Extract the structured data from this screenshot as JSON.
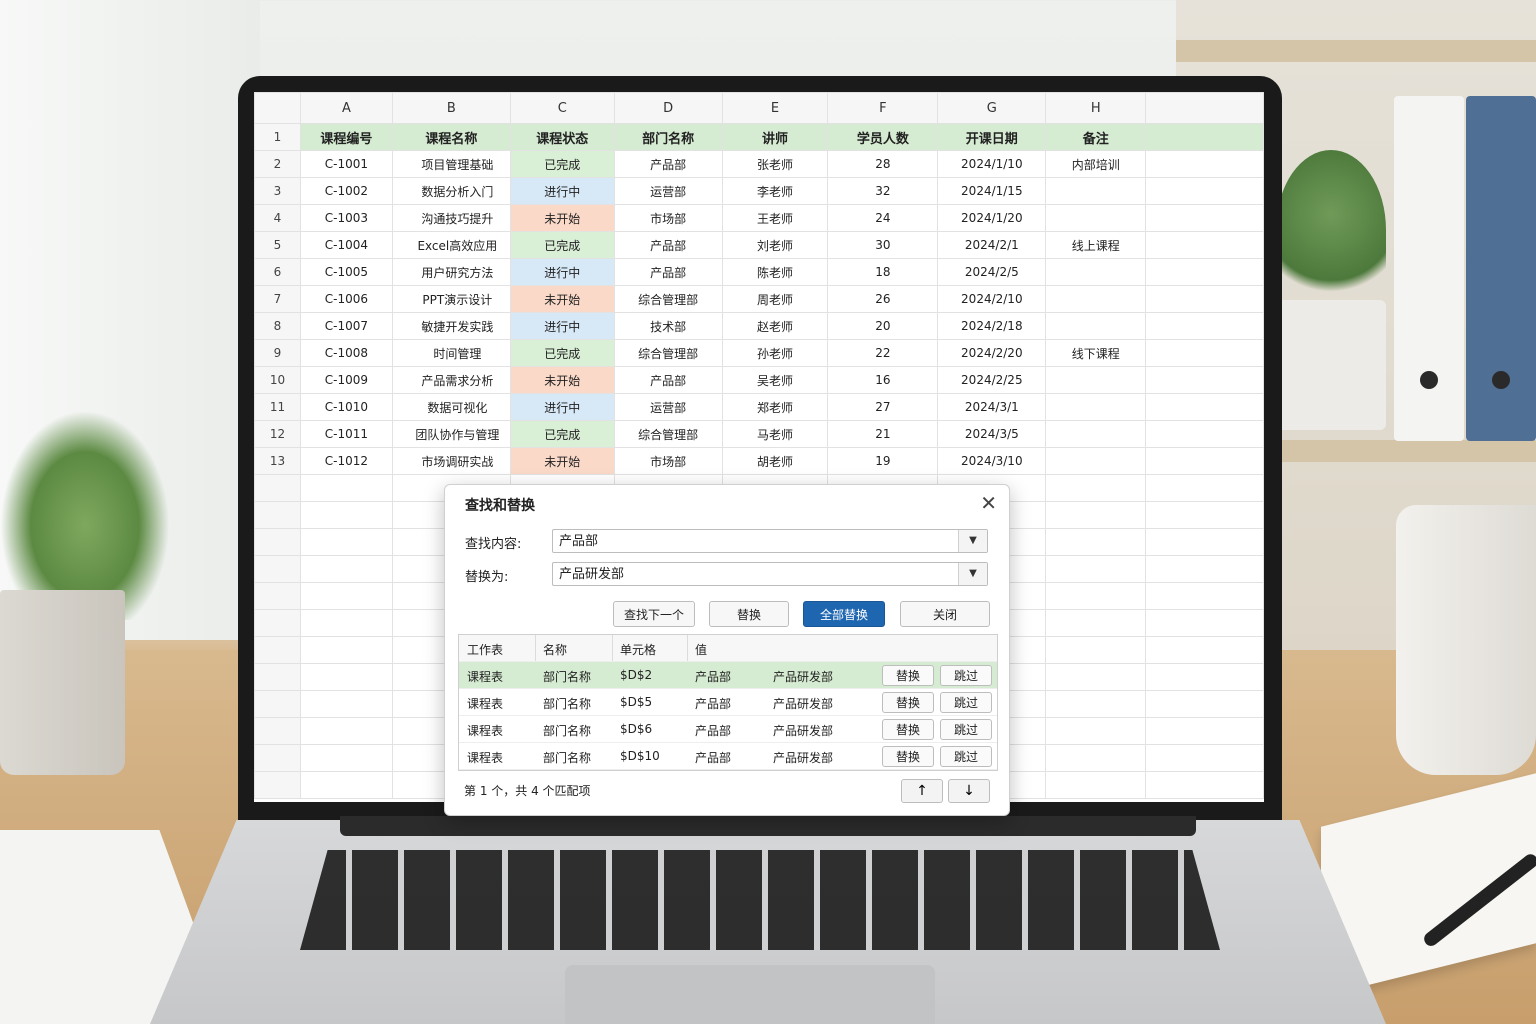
{
  "sheet": {
    "columns": [
      "",
      "A",
      "B",
      "C",
      "D",
      "E",
      "F",
      "G",
      "H"
    ],
    "header": [
      "课程编号",
      "课程名称",
      "课程状态",
      "部门名称",
      "讲师",
      "学员人数",
      "开课日期",
      "备注"
    ],
    "rows": [
      {
        "num": "2",
        "id": "C-1001",
        "name": "项目管理基础",
        "status": "已完成",
        "st": "done",
        "dept": "产品部",
        "teacher": "张老师",
        "count": "28",
        "date": "2024/1/10",
        "note": "内部培训"
      },
      {
        "num": "3",
        "id": "C-1002",
        "name": "数据分析入门",
        "status": "进行中",
        "st": "doing",
        "dept": "运营部",
        "teacher": "李老师",
        "count": "32",
        "date": "2024/1/15",
        "note": ""
      },
      {
        "num": "4",
        "id": "C-1003",
        "name": "沟通技巧提升",
        "status": "未开始",
        "st": "todo",
        "dept": "市场部",
        "teacher": "王老师",
        "count": "24",
        "date": "2024/1/20",
        "note": ""
      },
      {
        "num": "5",
        "id": "C-1004",
        "name": "Excel高效应用",
        "status": "已完成",
        "st": "done",
        "dept": "产品部",
        "teacher": "刘老师",
        "count": "30",
        "date": "2024/2/1",
        "note": "线上课程"
      },
      {
        "num": "6",
        "id": "C-1005",
        "name": "用户研究方法",
        "status": "进行中",
        "st": "doing",
        "dept": "产品部",
        "teacher": "陈老师",
        "count": "18",
        "date": "2024/2/5",
        "note": ""
      },
      {
        "num": "7",
        "id": "C-1006",
        "name": "PPT演示设计",
        "status": "未开始",
        "st": "todo",
        "dept": "综合管理部",
        "teacher": "周老师",
        "count": "26",
        "date": "2024/2/10",
        "note": ""
      },
      {
        "num": "8",
        "id": "C-1007",
        "name": "敏捷开发实践",
        "status": "进行中",
        "st": "doing",
        "dept": "技术部",
        "teacher": "赵老师",
        "count": "20",
        "date": "2024/2/18",
        "note": ""
      },
      {
        "num": "9",
        "id": "C-1008",
        "name": "时间管理",
        "status": "已完成",
        "st": "done",
        "dept": "综合管理部",
        "teacher": "孙老师",
        "count": "22",
        "date": "2024/2/20",
        "note": "线下课程"
      },
      {
        "num": "10",
        "id": "C-1009",
        "name": "产品需求分析",
        "status": "未开始",
        "st": "todo",
        "dept": "产品部",
        "teacher": "吴老师",
        "count": "16",
        "date": "2024/2/25",
        "note": ""
      },
      {
        "num": "11",
        "id": "C-1010",
        "name": "数据可视化",
        "status": "进行中",
        "st": "doing",
        "dept": "运营部",
        "teacher": "郑老师",
        "count": "27",
        "date": "2024/3/1",
        "note": ""
      },
      {
        "num": "12",
        "id": "C-1011",
        "name": "团队协作与管理",
        "status": "已完成",
        "st": "done",
        "dept": "综合管理部",
        "teacher": "马老师",
        "count": "21",
        "date": "2024/3/5",
        "note": ""
      },
      {
        "num": "13",
        "id": "C-1012",
        "name": "市场调研实战",
        "status": "未开始",
        "st": "todo",
        "dept": "市场部",
        "teacher": "胡老师",
        "count": "19",
        "date": "2024/3/10",
        "note": ""
      }
    ],
    "status_colors": {
      "done": "#d9efd6",
      "doing": "#d7e8f6",
      "todo": "#fad9c8"
    }
  },
  "dialog": {
    "title": "查找和替换",
    "find_label": "查找内容:",
    "find_value": "产品部",
    "replace_label": "替换为:",
    "replace_value": "产品研发部",
    "buttons": {
      "find_next": "查找下一个",
      "replace": "替换",
      "replace_all": "全部替换",
      "close": "关闭"
    },
    "result_columns": [
      "工作表",
      "名称",
      "单元格",
      "值"
    ],
    "results": [
      {
        "sheet": "课程表",
        "name": "部门名称",
        "cell": "$D$2",
        "value": "产品部",
        "new_value": "产品研发部"
      },
      {
        "sheet": "课程表",
        "name": "部门名称",
        "cell": "$D$5",
        "value": "产品部",
        "new_value": "产品研发部"
      },
      {
        "sheet": "课程表",
        "name": "部门名称",
        "cell": "$D$6",
        "value": "产品部",
        "new_value": "产品研发部"
      },
      {
        "sheet": "课程表",
        "name": "部门名称",
        "cell": "$D$10",
        "value": "产品部",
        "new_value": "产品研发部"
      }
    ],
    "row_replace_label": "替换",
    "row_skip_label": "跳过",
    "status": "第 1 个，共 4 个匹配项",
    "accent": "#1f66b1"
  }
}
